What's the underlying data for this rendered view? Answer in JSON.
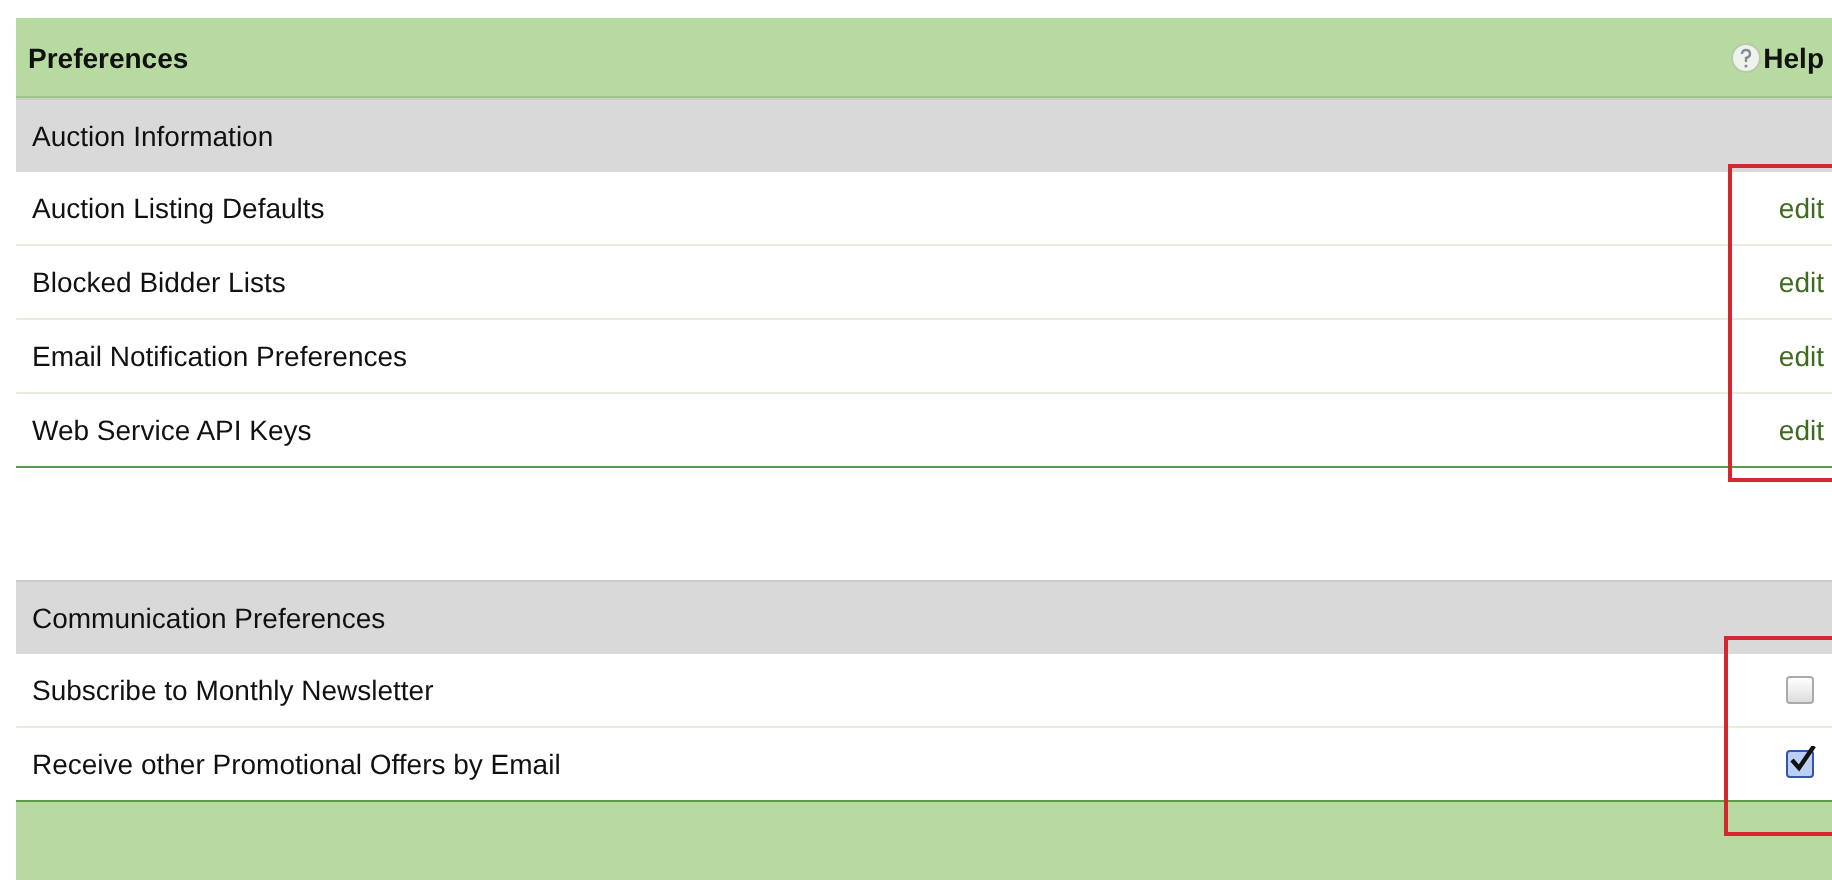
{
  "header": {
    "title": "Preferences",
    "help": "Help"
  },
  "sections": [
    {
      "title": "Auction Information",
      "highlighted": true,
      "rows": [
        {
          "label": "Auction Listing Defaults",
          "kind": "link",
          "action": "edit"
        },
        {
          "label": "Blocked Bidder Lists",
          "kind": "link",
          "action": "edit"
        },
        {
          "label": "Email Notification Preferences",
          "kind": "link",
          "action": "edit"
        },
        {
          "label": "Web Service API Keys",
          "kind": "link",
          "action": "edit"
        }
      ]
    },
    {
      "title": "Communication Preferences",
      "highlighted": true,
      "rows": [
        {
          "label": "Subscribe to Monthly Newsletter",
          "kind": "checkbox",
          "checked": false
        },
        {
          "label": "Receive other Promotional Offers by Email",
          "kind": "checkbox",
          "checked": true
        }
      ]
    }
  ]
}
